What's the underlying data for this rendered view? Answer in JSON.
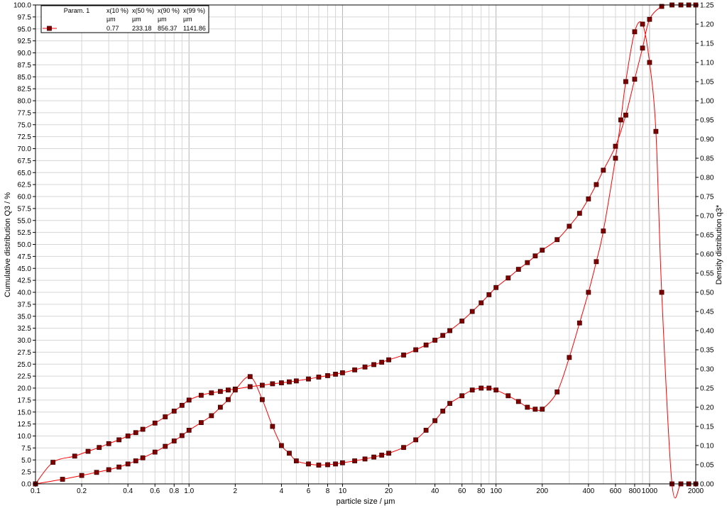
{
  "chart_data": {
    "type": "line",
    "title": "",
    "xlabel": "particle size / µm",
    "ylabel_left": "Cumulative distribution Q3 / %",
    "ylabel_right": "Density distribution q3*",
    "x_scale": "log",
    "xlim": [
      0.1,
      2000
    ],
    "ylim_left": [
      0,
      100
    ],
    "ylim_right": [
      0,
      1.25
    ],
    "grid": true,
    "legend_position": "top-left",
    "colors": {
      "line": "#ff0000",
      "marker_fill": "#800000",
      "marker_edge": "#400000"
    },
    "x_ticks": [
      {
        "v": 0.1,
        "label": "0.1"
      },
      {
        "v": 0.2,
        "label": "0.2"
      },
      {
        "v": 0.4,
        "label": "0.4"
      },
      {
        "v": 0.6,
        "label": "0.6"
      },
      {
        "v": 0.8,
        "label": "0.8"
      },
      {
        "v": 1.0,
        "label": "1.0"
      },
      {
        "v": 2,
        "label": "2"
      },
      {
        "v": 4,
        "label": "4"
      },
      {
        "v": 6,
        "label": "6"
      },
      {
        "v": 8,
        "label": "8"
      },
      {
        "v": 10,
        "label": "10"
      },
      {
        "v": 20,
        "label": "20"
      },
      {
        "v": 40,
        "label": "40"
      },
      {
        "v": 60,
        "label": "60"
      },
      {
        "v": 80,
        "label": "80"
      },
      {
        "v": 100,
        "label": "100"
      },
      {
        "v": 200,
        "label": "200"
      },
      {
        "v": 400,
        "label": "400"
      },
      {
        "v": 600,
        "label": "600"
      },
      {
        "v": 800,
        "label": "800"
      },
      {
        "v": 1000,
        "label": "1000"
      },
      {
        "v": 2000,
        "label": "2000"
      }
    ],
    "y_left_ticks": [
      {
        "v": 0,
        "label": "0.0"
      },
      {
        "v": 2.5,
        "label": "2.5"
      },
      {
        "v": 5,
        "label": "5.0"
      },
      {
        "v": 7.5,
        "label": "7.5"
      },
      {
        "v": 10,
        "label": "10.0"
      },
      {
        "v": 12.5,
        "label": "12.5"
      },
      {
        "v": 15,
        "label": "15.0"
      },
      {
        "v": 17.5,
        "label": "17.5"
      },
      {
        "v": 20,
        "label": "20.0"
      },
      {
        "v": 22.5,
        "label": "22.5"
      },
      {
        "v": 25,
        "label": "25.0"
      },
      {
        "v": 27.5,
        "label": "27.5"
      },
      {
        "v": 30,
        "label": "30.0"
      },
      {
        "v": 32.5,
        "label": "32.5"
      },
      {
        "v": 35,
        "label": "35.0"
      },
      {
        "v": 37.5,
        "label": "37.5"
      },
      {
        "v": 40,
        "label": "40.0"
      },
      {
        "v": 42.5,
        "label": "42.5"
      },
      {
        "v": 45,
        "label": "45.0"
      },
      {
        "v": 47.5,
        "label": "47.5"
      },
      {
        "v": 50,
        "label": "50.0"
      },
      {
        "v": 52.5,
        "label": "52.5"
      },
      {
        "v": 55,
        "label": "55.0"
      },
      {
        "v": 57.5,
        "label": "57.5"
      },
      {
        "v": 60,
        "label": "60.0"
      },
      {
        "v": 62.5,
        "label": "62.5"
      },
      {
        "v": 65,
        "label": "65.0"
      },
      {
        "v": 67.5,
        "label": "67.5"
      },
      {
        "v": 70,
        "label": "70.0"
      },
      {
        "v": 72.5,
        "label": "72.5"
      },
      {
        "v": 75,
        "label": "75.0"
      },
      {
        "v": 77.5,
        "label": "77.5"
      },
      {
        "v": 80,
        "label": "80.0"
      },
      {
        "v": 82.5,
        "label": "82.5"
      },
      {
        "v": 85,
        "label": "85.0"
      },
      {
        "v": 87.5,
        "label": "87.5"
      },
      {
        "v": 90,
        "label": "90.0"
      },
      {
        "v": 92.5,
        "label": "92.5"
      },
      {
        "v": 95,
        "label": "95.0"
      },
      {
        "v": 97.5,
        "label": "97.5"
      },
      {
        "v": 100,
        "label": "100.0"
      }
    ],
    "y_right_ticks": [
      {
        "v": 0,
        "label": "0.00"
      },
      {
        "v": 0.05,
        "label": "0.05"
      },
      {
        "v": 0.1,
        "label": "0.10"
      },
      {
        "v": 0.15,
        "label": "0.15"
      },
      {
        "v": 0.2,
        "label": "0.20"
      },
      {
        "v": 0.25,
        "label": "0.25"
      },
      {
        "v": 0.3,
        "label": "0.30"
      },
      {
        "v": 0.35,
        "label": "0.35"
      },
      {
        "v": 0.4,
        "label": "0.40"
      },
      {
        "v": 0.45,
        "label": "0.45"
      },
      {
        "v": 0.5,
        "label": "0.50"
      },
      {
        "v": 0.55,
        "label": "0.55"
      },
      {
        "v": 0.6,
        "label": "0.60"
      },
      {
        "v": 0.65,
        "label": "0.65"
      },
      {
        "v": 0.7,
        "label": "0.70"
      },
      {
        "v": 0.75,
        "label": "0.75"
      },
      {
        "v": 0.8,
        "label": "0.80"
      },
      {
        "v": 0.85,
        "label": "0.85"
      },
      {
        "v": 0.9,
        "label": "0.90"
      },
      {
        "v": 0.95,
        "label": "0.95"
      },
      {
        "v": 1.0,
        "label": "1.00"
      },
      {
        "v": 1.05,
        "label": "1.05"
      },
      {
        "v": 1.1,
        "label": "1.10"
      },
      {
        "v": 1.15,
        "label": "1.15"
      },
      {
        "v": 1.2,
        "label": "1.20"
      },
      {
        "v": 1.25,
        "label": "1.25"
      }
    ],
    "series": [
      {
        "axis": "left",
        "x": [
          0.1,
          0.13,
          0.18,
          0.22,
          0.26,
          0.3,
          0.35,
          0.4,
          0.45,
          0.5,
          0.6,
          0.7,
          0.8,
          0.9,
          1.0,
          1.2,
          1.4,
          1.6,
          1.8,
          2.0,
          2.5,
          3.0,
          3.5,
          4.0,
          4.5,
          5.0,
          6.0,
          7.0,
          8.0,
          9.0,
          10,
          12,
          14,
          16,
          18,
          20,
          25,
          30,
          35,
          40,
          45,
          50,
          60,
          70,
          80,
          90,
          100,
          120,
          140,
          160,
          180,
          200,
          250,
          300,
          350,
          400,
          450,
          500,
          600,
          700,
          800,
          900,
          1000,
          1200,
          1400,
          1600,
          1800,
          2000
        ],
        "values": [
          0,
          4.5,
          5.8,
          6.8,
          7.6,
          8.4,
          9.2,
          10.0,
          10.7,
          11.4,
          12.7,
          14.0,
          15.2,
          16.4,
          17.5,
          18.5,
          19.0,
          19.3,
          19.6,
          19.8,
          20.3,
          20.6,
          20.9,
          21.1,
          21.3,
          21.5,
          21.9,
          22.3,
          22.6,
          22.9,
          23.2,
          23.8,
          24.4,
          24.9,
          25.4,
          25.9,
          26.9,
          28.0,
          29.0,
          30.0,
          31.0,
          32.0,
          34.0,
          36.0,
          37.8,
          39.5,
          41.0,
          43.0,
          44.8,
          46.2,
          47.6,
          48.8,
          51.0,
          53.8,
          56.5,
          59.5,
          62.5,
          65.5,
          70.5,
          77.0,
          84.5,
          91.0,
          97.0,
          99.7,
          100,
          100,
          100,
          100
        ]
      },
      {
        "axis": "right",
        "x": [
          0.1,
          0.15,
          0.2,
          0.25,
          0.3,
          0.35,
          0.4,
          0.45,
          0.5,
          0.6,
          0.7,
          0.8,
          0.9,
          1.0,
          1.2,
          1.4,
          1.6,
          1.8,
          2.0,
          2.5,
          3.0,
          3.5,
          4.0,
          4.5,
          5.0,
          6.0,
          7.0,
          8.0,
          9.0,
          10,
          12,
          14,
          16,
          18,
          20,
          25,
          30,
          35,
          40,
          45,
          50,
          60,
          70,
          80,
          90,
          100,
          120,
          140,
          160,
          180,
          200,
          250,
          300,
          350,
          400,
          450,
          500,
          600,
          650,
          700,
          800,
          900,
          1000,
          1100,
          1200,
          1400,
          1600,
          1800,
          2000
        ],
        "values": [
          0,
          0.012,
          0.022,
          0.03,
          0.037,
          0.044,
          0.052,
          0.06,
          0.068,
          0.083,
          0.098,
          0.112,
          0.126,
          0.14,
          0.16,
          0.178,
          0.2,
          0.22,
          0.245,
          0.28,
          0.22,
          0.15,
          0.1,
          0.08,
          0.06,
          0.052,
          0.049,
          0.05,
          0.052,
          0.055,
          0.06,
          0.065,
          0.07,
          0.075,
          0.08,
          0.095,
          0.115,
          0.14,
          0.165,
          0.19,
          0.21,
          0.23,
          0.245,
          0.25,
          0.25,
          0.245,
          0.23,
          0.215,
          0.2,
          0.195,
          0.195,
          0.24,
          0.33,
          0.42,
          0.5,
          0.58,
          0.66,
          0.85,
          0.95,
          1.05,
          1.18,
          1.2,
          1.1,
          0.92,
          0.5,
          0.0,
          0.0,
          0.0,
          0.0
        ]
      }
    ]
  },
  "legend": {
    "headers": [
      "Param. 1",
      "x(10 %)",
      "x(50 %)",
      "x(90 %)",
      "x(99 %)"
    ],
    "units": [
      "",
      "µm",
      "µm",
      "µm",
      "µm"
    ],
    "values": [
      "",
      "0.77",
      "233.18",
      "856.37",
      "1141.86"
    ]
  }
}
